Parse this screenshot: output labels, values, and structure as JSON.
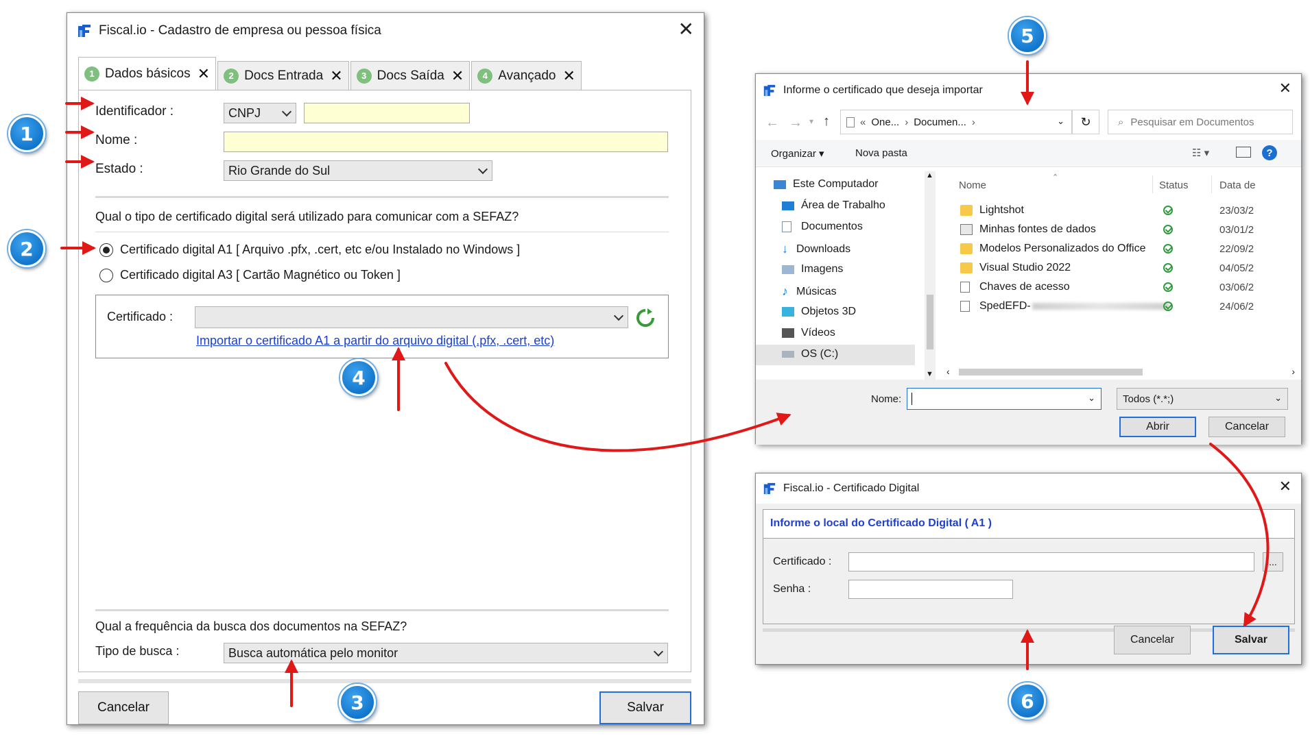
{
  "main_window": {
    "title": "Fiscal.io - Cadastro de empresa ou pessoa física",
    "tabs": [
      {
        "num": "1",
        "label": "Dados básicos"
      },
      {
        "num": "2",
        "label": "Docs Entrada"
      },
      {
        "num": "3",
        "label": "Docs Saída"
      },
      {
        "num": "4",
        "label": "Avançado"
      }
    ],
    "identificador_label": "Identificador :",
    "identificador_type": "CNPJ",
    "identificador_value": "",
    "nome_label": "Nome :",
    "nome_value": "",
    "estado_label": "Estado :",
    "estado_value": "Rio Grande do Sul",
    "cert_question": "Qual o tipo de certificado digital será utilizado para comunicar com a SEFAZ?",
    "radio_a1": "Certificado digital A1 [ Arquivo .pfx, .cert, etc e/ou Instalado no Windows ]",
    "radio_a3": "Certificado digital A3 [ Cartão Magnético ou Token ]",
    "selected_radio": "A1",
    "certificado_label": "Certificado :",
    "certificado_value": "",
    "import_link": "Importar o certificado A1 a partir do arquivo digital (.pfx, .cert, etc)",
    "freq_question": "Qual a frequência da busca dos documentos na SEFAZ?",
    "tipo_busca_label": "Tipo de busca :",
    "tipo_busca_value": "Busca automática pelo monitor",
    "cancel_label": "Cancelar",
    "save_label": "Salvar"
  },
  "file_dialog": {
    "title": "Informe o certificado que deseja importar",
    "path": [
      "«",
      "One...",
      "›",
      "Documen...",
      "›"
    ],
    "search_placeholder": "Pesquisar em Documentos",
    "organize_label": "Organizar",
    "new_folder_label": "Nova pasta",
    "nav_items": [
      {
        "label": "Este Computador",
        "icon": "computer-icon"
      },
      {
        "label": "Área de Trabalho",
        "icon": "desktop-icon"
      },
      {
        "label": "Documentos",
        "icon": "documents-icon"
      },
      {
        "label": "Downloads",
        "icon": "downloads-icon"
      },
      {
        "label": "Imagens",
        "icon": "images-icon"
      },
      {
        "label": "Músicas",
        "icon": "music-icon"
      },
      {
        "label": "Objetos 3D",
        "icon": "objects3d-icon"
      },
      {
        "label": "Vídeos",
        "icon": "videos-icon"
      },
      {
        "label": "OS (C:)",
        "icon": "drive-icon"
      }
    ],
    "col_name": "Nome",
    "col_status": "Status",
    "col_date": "Data de",
    "files": [
      {
        "name": "Lightshot",
        "date": "23/03/2"
      },
      {
        "name": "Minhas fontes de dados",
        "date": "03/01/2"
      },
      {
        "name": "Modelos Personalizados do Office",
        "date": "22/09/2"
      },
      {
        "name": "Visual Studio 2022",
        "date": "04/05/2"
      },
      {
        "name": "Chaves de acesso",
        "date": "03/06/2"
      },
      {
        "name": "SpedEFD-",
        "date": "24/06/2"
      }
    ],
    "filename_label": "Nome:",
    "filename_value": "",
    "filter_value": "Todos (*.*;)",
    "open_label": "Abrir",
    "cancel_label": "Cancelar"
  },
  "cert_dialog": {
    "title": "Fiscal.io - Certificado Digital",
    "heading": "Informe o local do Certificado Digital ( A1 )",
    "certificado_label": "Certificado :",
    "senha_label": "Senha :",
    "browse_label": "...",
    "cancel_label": "Cancelar",
    "save_label": "Salvar"
  },
  "badges": [
    "1",
    "2",
    "3",
    "4",
    "5",
    "6"
  ],
  "colors": {
    "accent_blue": "#1276cc",
    "arrow_red": "#e01818",
    "link_blue": "#1a3fd6",
    "heading_blue": "#1f3fd0",
    "required_yellow": "#ffffd4",
    "tab_green": "#7fc07f"
  }
}
